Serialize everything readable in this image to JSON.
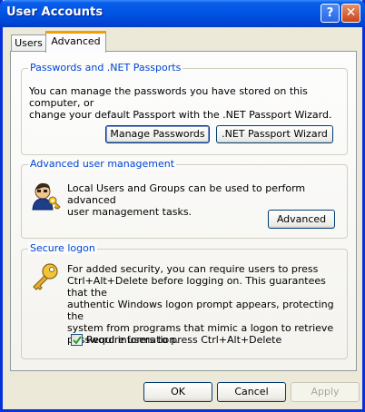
{
  "window": {
    "title": "User Accounts",
    "help_label": "?",
    "close_label": "✕"
  },
  "tabs": [
    {
      "label": "Users"
    },
    {
      "label": "Advanced"
    }
  ],
  "passwords": {
    "legend": "Passwords and .NET Passports",
    "line1": "You can manage the passwords you have stored on this computer, or",
    "line2": "change your default Passport with the .NET Passport Wizard.",
    "manage_button": "Manage Passwords",
    "wizard_button": ".NET Passport Wizard"
  },
  "advanced_management": {
    "legend": "Advanced user management",
    "line1": "Local Users and Groups can be used to perform advanced",
    "line2": "user management tasks.",
    "button": "Advanced"
  },
  "secure_logon": {
    "legend": "Secure logon",
    "lines": [
      "For added security, you can require users to press",
      "Ctrl+Alt+Delete before logging on. This guarantees that the",
      "authentic Windows logon prompt appears, protecting the",
      "system from programs that mimic a logon to retrieve",
      "password information."
    ],
    "checkbox_label": "Require users to press Ctrl+Alt+Delete",
    "checked": true
  },
  "footer": {
    "ok": "OK",
    "cancel": "Cancel",
    "apply": "Apply"
  },
  "colors": {
    "title_blue": "#0054e3",
    "legend_blue": "#0046d5",
    "tab_accent": "#f0a000"
  }
}
